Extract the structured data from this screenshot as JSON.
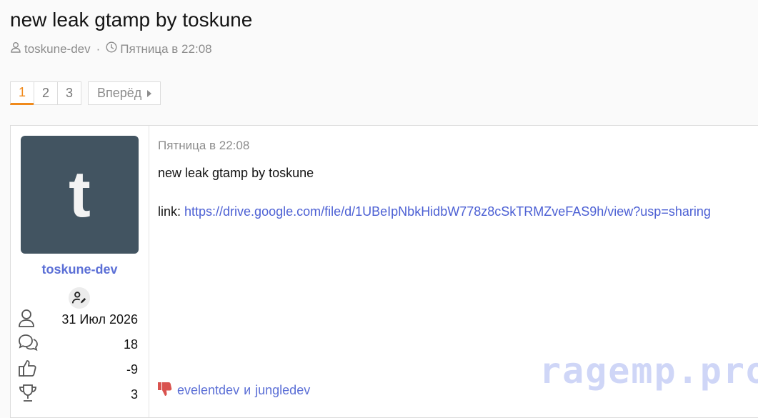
{
  "thread": {
    "title": "new leak gtamp by toskune",
    "author": "toskune-dev",
    "separator": "·",
    "date": "Пятница в 22:08"
  },
  "pagination": {
    "pages": [
      "1",
      "2",
      "3"
    ],
    "current": "1",
    "next_label": "Вперёд"
  },
  "post": {
    "user": {
      "avatar_letter": "t",
      "name": "toskune-dev",
      "stats": [
        {
          "icon": "user-icon",
          "value": "31 Июл 2026"
        },
        {
          "icon": "messages-icon",
          "value": "18"
        },
        {
          "icon": "thumbs-up-icon",
          "value": "-9"
        },
        {
          "icon": "trophy-icon",
          "value": "3"
        }
      ]
    },
    "date": "Пятница в 22:08",
    "text": "new leak gtamp by toskune",
    "link_prefix": "link: ",
    "link_url": "https://drive.google.com/file/d/1UBeIpNbkHidbW778z8cSkTRMZveFAS9h/view?usp=sharing",
    "reactions": {
      "icon": "dislike-icon",
      "user1": "evelentdev",
      "joiner": "и",
      "user2": "jungledev"
    }
  },
  "watermark": "ragemp.pro",
  "colors": {
    "accent": "#f08a1c",
    "link": "#4c60d4",
    "avatar_bg": "#425461",
    "dislike": "#d9534f"
  }
}
